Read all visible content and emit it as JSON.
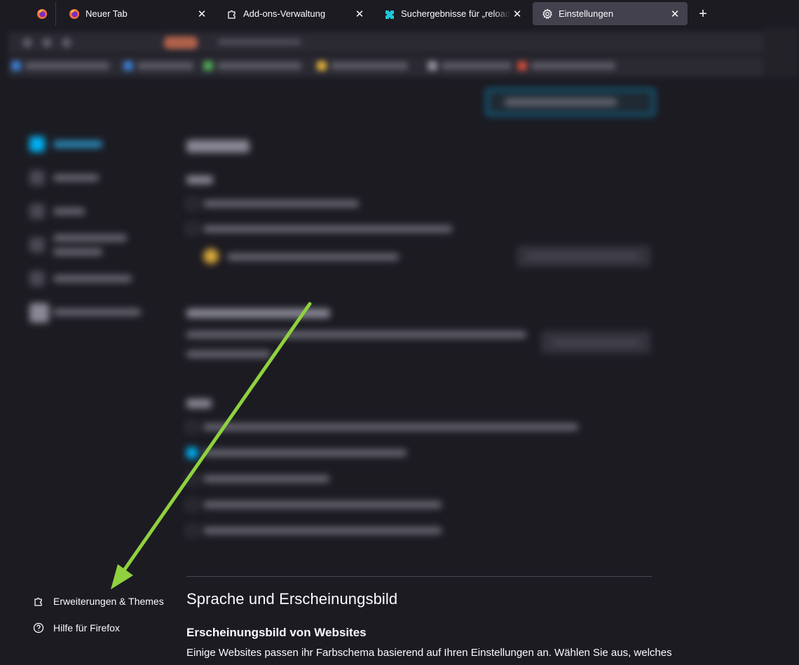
{
  "tabs": [
    {
      "title": "Neuer Tab",
      "icon": "firefox-icon",
      "selected": false
    },
    {
      "title": "Add-ons-Verwaltung",
      "icon": "puzzle-icon",
      "selected": false
    },
    {
      "title": "Suchergebnisse für „reloader“ – Add-ons für Firefox",
      "icon": "addons-icon",
      "selected": false
    },
    {
      "title": "Einstellungen",
      "icon": "gear-icon",
      "selected": true
    }
  ],
  "sidebar_footer": {
    "extensions_label": "Erweiterungen & Themes",
    "help_label": "Hilfe für Firefox"
  },
  "main": {
    "section_title": "Sprache und Erscheinungsbild",
    "subsection_title": "Erscheinungsbild von Websites",
    "description": "Einige Websites passen ihr Farbschema basierend auf Ihren Einstellungen an. Wählen Sie aus, welches"
  },
  "colors": {
    "background": "#1c1b22",
    "selected_tab": "#42414d",
    "accent": "#00b3f4",
    "arrow": "#8fd13f"
  }
}
